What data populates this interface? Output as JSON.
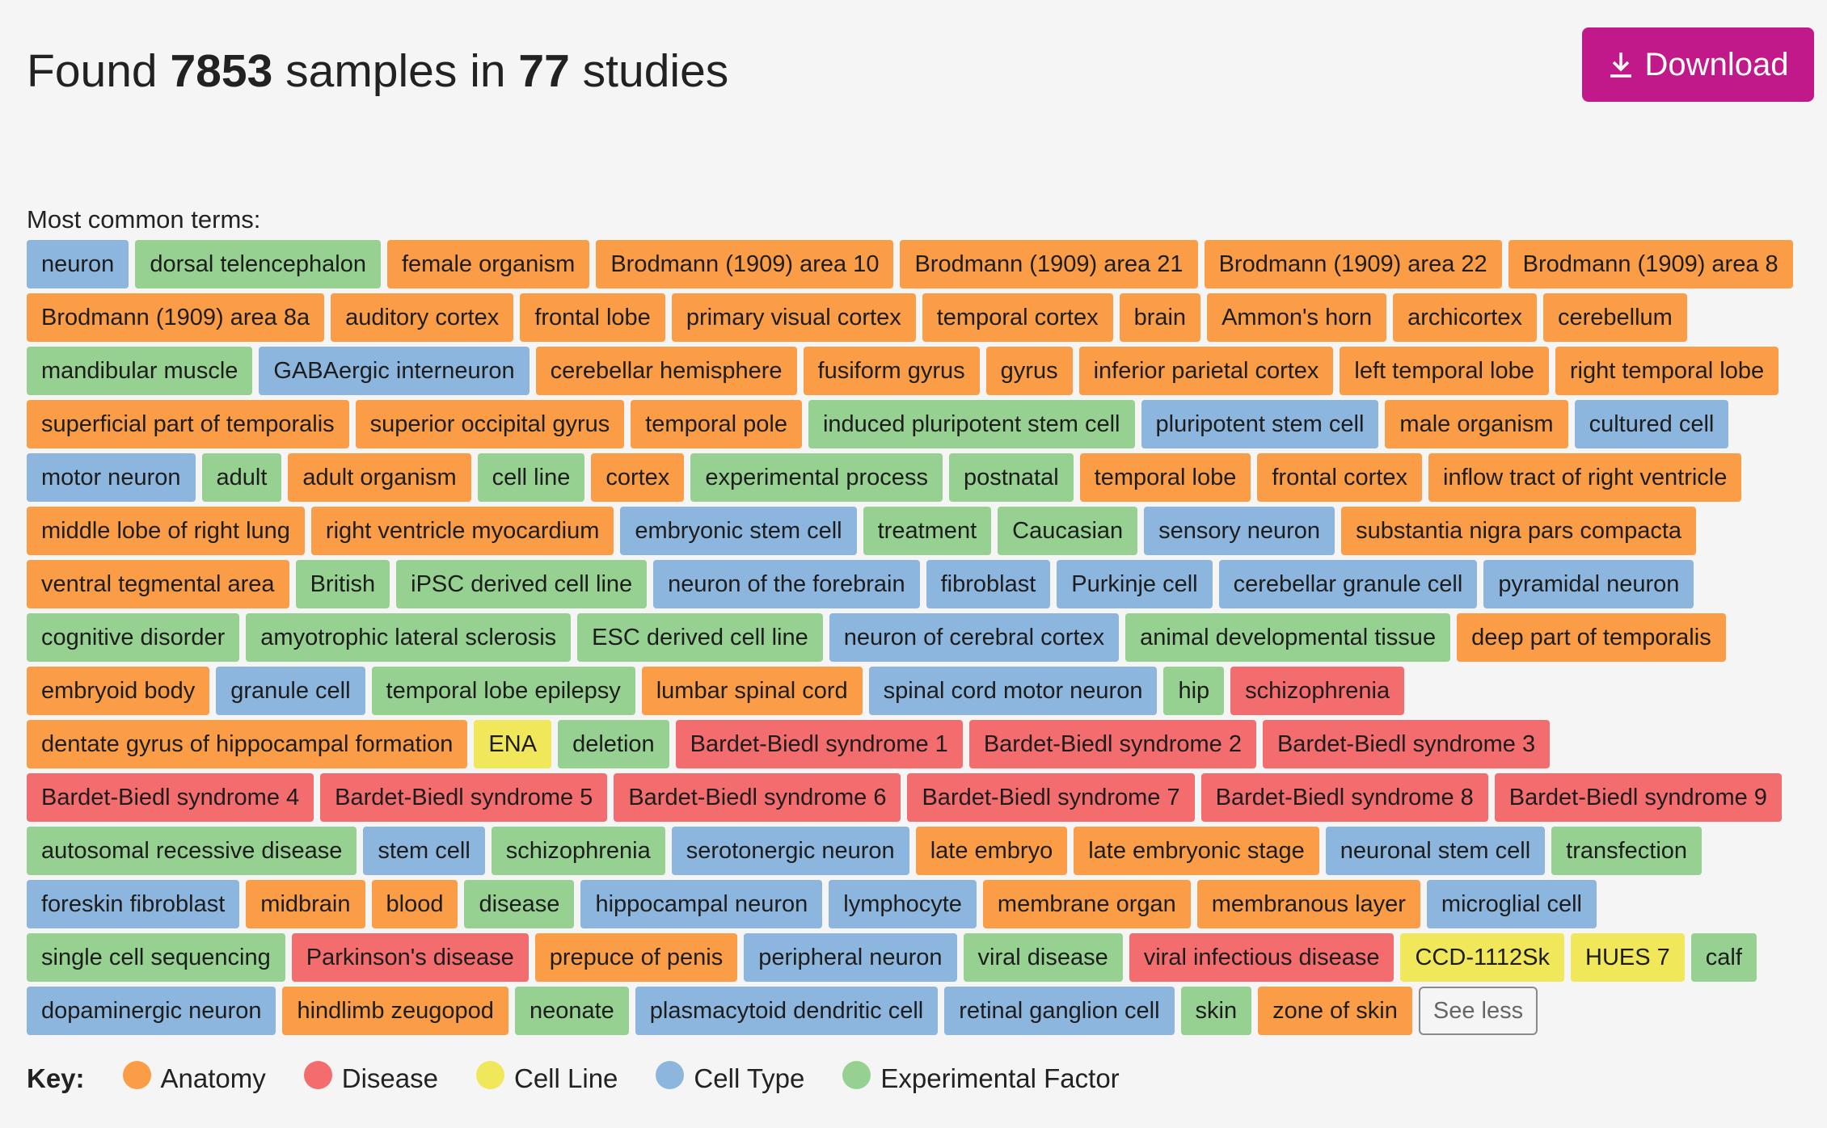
{
  "header": {
    "prefix": "Found",
    "sample_count": "7853",
    "middle": "samples in",
    "study_count": "77",
    "suffix": "studies",
    "download_label": "Download"
  },
  "terms_label": "Most common terms:",
  "see_less_label": "See less",
  "colors": {
    "anatomy": "#fb9d46",
    "disease": "#f36c6e",
    "cellline": "#f0e85a",
    "celltype": "#8db6de",
    "expfactor": "#96d191",
    "download": "#c2198a"
  },
  "key": {
    "label": "Key:",
    "items": [
      {
        "label": "Anatomy",
        "type": "anatomy"
      },
      {
        "label": "Disease",
        "type": "disease"
      },
      {
        "label": "Cell Line",
        "type": "cellline"
      },
      {
        "label": "Cell Type",
        "type": "celltype"
      },
      {
        "label": "Experimental Factor",
        "type": "expfactor"
      }
    ]
  },
  "tags": [
    {
      "label": "neuron",
      "type": "celltype"
    },
    {
      "label": "dorsal telencephalon",
      "type": "expfactor"
    },
    {
      "label": "female organism",
      "type": "anatomy"
    },
    {
      "label": "Brodmann (1909) area 10",
      "type": "anatomy"
    },
    {
      "label": "Brodmann (1909) area 21",
      "type": "anatomy"
    },
    {
      "label": "Brodmann (1909) area 22",
      "type": "anatomy"
    },
    {
      "label": "Brodmann (1909) area 8",
      "type": "anatomy"
    },
    {
      "label": "Brodmann (1909) area 8a",
      "type": "anatomy"
    },
    {
      "label": "auditory cortex",
      "type": "anatomy"
    },
    {
      "label": "frontal lobe",
      "type": "anatomy"
    },
    {
      "label": "primary visual cortex",
      "type": "anatomy"
    },
    {
      "label": "temporal cortex",
      "type": "anatomy"
    },
    {
      "label": "brain",
      "type": "anatomy"
    },
    {
      "label": "Ammon's horn",
      "type": "anatomy"
    },
    {
      "label": "archicortex",
      "type": "anatomy"
    },
    {
      "label": "cerebellum",
      "type": "anatomy"
    },
    {
      "label": "mandibular muscle",
      "type": "expfactor"
    },
    {
      "label": "GABAergic interneuron",
      "type": "celltype"
    },
    {
      "label": "cerebellar hemisphere",
      "type": "anatomy"
    },
    {
      "label": "fusiform gyrus",
      "type": "anatomy"
    },
    {
      "label": "gyrus",
      "type": "anatomy"
    },
    {
      "label": "inferior parietal cortex",
      "type": "anatomy"
    },
    {
      "label": "left temporal lobe",
      "type": "anatomy"
    },
    {
      "label": "right temporal lobe",
      "type": "anatomy"
    },
    {
      "label": "superficial part of temporalis",
      "type": "anatomy"
    },
    {
      "label": "superior occipital gyrus",
      "type": "anatomy"
    },
    {
      "label": "temporal pole",
      "type": "anatomy"
    },
    {
      "label": "induced pluripotent stem cell",
      "type": "expfactor"
    },
    {
      "label": "pluripotent stem cell",
      "type": "celltype"
    },
    {
      "label": "male organism",
      "type": "anatomy"
    },
    {
      "label": "cultured cell",
      "type": "celltype"
    },
    {
      "label": "motor neuron",
      "type": "celltype"
    },
    {
      "label": "adult",
      "type": "expfactor"
    },
    {
      "label": "adult organism",
      "type": "anatomy"
    },
    {
      "label": "cell line",
      "type": "expfactor"
    },
    {
      "label": "cortex",
      "type": "anatomy"
    },
    {
      "label": "experimental process",
      "type": "expfactor"
    },
    {
      "label": "postnatal",
      "type": "expfactor"
    },
    {
      "label": "temporal lobe",
      "type": "anatomy"
    },
    {
      "label": "frontal cortex",
      "type": "anatomy"
    },
    {
      "label": "inflow tract of right ventricle",
      "type": "anatomy"
    },
    {
      "label": "middle lobe of right lung",
      "type": "anatomy"
    },
    {
      "label": "right ventricle myocardium",
      "type": "anatomy"
    },
    {
      "label": "embryonic stem cell",
      "type": "celltype"
    },
    {
      "label": "treatment",
      "type": "expfactor"
    },
    {
      "label": "Caucasian",
      "type": "expfactor"
    },
    {
      "label": "sensory neuron",
      "type": "celltype"
    },
    {
      "label": "substantia nigra pars compacta",
      "type": "anatomy"
    },
    {
      "label": "ventral tegmental area",
      "type": "anatomy"
    },
    {
      "label": "British",
      "type": "expfactor"
    },
    {
      "label": "iPSC derived cell line",
      "type": "expfactor"
    },
    {
      "label": "neuron of the forebrain",
      "type": "celltype"
    },
    {
      "label": "fibroblast",
      "type": "celltype"
    },
    {
      "label": "Purkinje cell",
      "type": "celltype"
    },
    {
      "label": "cerebellar granule cell",
      "type": "celltype"
    },
    {
      "label": "pyramidal neuron",
      "type": "celltype"
    },
    {
      "label": "cognitive disorder",
      "type": "expfactor"
    },
    {
      "label": "amyotrophic lateral sclerosis",
      "type": "expfactor"
    },
    {
      "label": "ESC derived cell line",
      "type": "expfactor"
    },
    {
      "label": "neuron of cerebral cortex",
      "type": "celltype"
    },
    {
      "label": "animal developmental tissue",
      "type": "expfactor"
    },
    {
      "label": "deep part of temporalis",
      "type": "anatomy"
    },
    {
      "label": "embryoid body",
      "type": "anatomy"
    },
    {
      "label": "granule cell",
      "type": "celltype"
    },
    {
      "label": "temporal lobe epilepsy",
      "type": "expfactor"
    },
    {
      "label": "lumbar spinal cord",
      "type": "anatomy"
    },
    {
      "label": "spinal cord motor neuron",
      "type": "celltype"
    },
    {
      "label": "hip",
      "type": "expfactor"
    },
    {
      "label": "schizophrenia",
      "type": "disease"
    },
    {
      "label": "dentate gyrus of hippocampal formation",
      "type": "anatomy"
    },
    {
      "label": "ENA",
      "type": "cellline"
    },
    {
      "label": "deletion",
      "type": "expfactor"
    },
    {
      "label": "Bardet-Biedl syndrome 1",
      "type": "disease"
    },
    {
      "label": "Bardet-Biedl syndrome 2",
      "type": "disease"
    },
    {
      "label": "Bardet-Biedl syndrome 3",
      "type": "disease"
    },
    {
      "label": "Bardet-Biedl syndrome 4",
      "type": "disease"
    },
    {
      "label": "Bardet-Biedl syndrome 5",
      "type": "disease"
    },
    {
      "label": "Bardet-Biedl syndrome 6",
      "type": "disease"
    },
    {
      "label": "Bardet-Biedl syndrome 7",
      "type": "disease"
    },
    {
      "label": "Bardet-Biedl syndrome 8",
      "type": "disease"
    },
    {
      "label": "Bardet-Biedl syndrome 9",
      "type": "disease"
    },
    {
      "label": "autosomal recessive disease",
      "type": "expfactor"
    },
    {
      "label": "stem cell",
      "type": "celltype"
    },
    {
      "label": "schizophrenia",
      "type": "expfactor"
    },
    {
      "label": "serotonergic neuron",
      "type": "celltype"
    },
    {
      "label": "late embryo",
      "type": "anatomy"
    },
    {
      "label": "late embryonic stage",
      "type": "anatomy"
    },
    {
      "label": "neuronal stem cell",
      "type": "celltype"
    },
    {
      "label": "transfection",
      "type": "expfactor"
    },
    {
      "label": "foreskin fibroblast",
      "type": "celltype"
    },
    {
      "label": "midbrain",
      "type": "anatomy"
    },
    {
      "label": "blood",
      "type": "anatomy"
    },
    {
      "label": "disease",
      "type": "expfactor"
    },
    {
      "label": "hippocampal neuron",
      "type": "celltype"
    },
    {
      "label": "lymphocyte",
      "type": "celltype"
    },
    {
      "label": "membrane organ",
      "type": "anatomy"
    },
    {
      "label": "membranous layer",
      "type": "anatomy"
    },
    {
      "label": "microglial cell",
      "type": "celltype"
    },
    {
      "label": "single cell sequencing",
      "type": "expfactor"
    },
    {
      "label": "Parkinson's disease",
      "type": "disease"
    },
    {
      "label": "prepuce of penis",
      "type": "anatomy"
    },
    {
      "label": "peripheral neuron",
      "type": "celltype"
    },
    {
      "label": "viral disease",
      "type": "expfactor"
    },
    {
      "label": "viral infectious disease",
      "type": "disease"
    },
    {
      "label": "CCD-1112Sk",
      "type": "cellline"
    },
    {
      "label": "HUES 7",
      "type": "cellline"
    },
    {
      "label": "calf",
      "type": "expfactor"
    },
    {
      "label": "dopaminergic neuron",
      "type": "celltype"
    },
    {
      "label": "hindlimb zeugopod",
      "type": "anatomy"
    },
    {
      "label": "neonate",
      "type": "expfactor"
    },
    {
      "label": "plasmacytoid dendritic cell",
      "type": "celltype"
    },
    {
      "label": "retinal ganglion cell",
      "type": "celltype"
    },
    {
      "label": "skin",
      "type": "expfactor"
    },
    {
      "label": "zone of skin",
      "type": "anatomy"
    }
  ]
}
